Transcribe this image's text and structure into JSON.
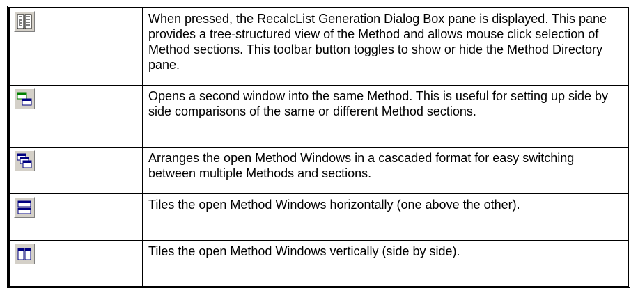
{
  "rows": [
    {
      "icon": "method-directory-toggle-icon",
      "description": "When pressed, the RecalcList Generation Dialog Box pane is displayed. This pane provides a tree-structured view of the Method and allows mouse click selection of Method sections. This toolbar button toggles to show or hide the Method Directory pane."
    },
    {
      "icon": "new-window-icon",
      "description": "Opens a second window into the same Method. This is useful for setting up side by side comparisons of the same or different Method sections."
    },
    {
      "icon": "cascade-windows-icon",
      "description": "Arranges the open Method Windows in a cascaded format for easy switching between multiple Methods and sections."
    },
    {
      "icon": "tile-horizontal-icon",
      "description": "Tiles the open Method Windows horizontally (one above the other)."
    },
    {
      "icon": "tile-vertical-icon",
      "description": "Tiles the open Method Windows vertically (side by side)."
    }
  ]
}
